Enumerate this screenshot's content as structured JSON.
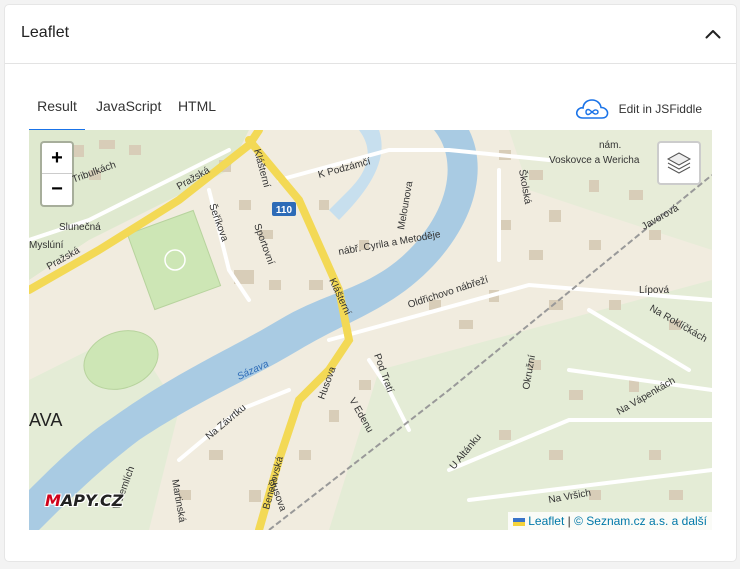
{
  "panel": {
    "title": "Leaflet"
  },
  "tabs": [
    {
      "label": "Result",
      "active": true
    },
    {
      "label": "JavaScript",
      "active": false
    },
    {
      "label": "HTML",
      "active": false
    }
  ],
  "jsfiddle": {
    "label": "Edit in JSFiddle",
    "icon": "cloud-icon"
  },
  "map": {
    "zoom_in": "+",
    "zoom_out": "−",
    "logo": {
      "prefix": "M",
      "rest": "APY.CZ"
    },
    "edge_label": "AVA",
    "attribution": {
      "leaflet": "Leaflet",
      "separator": "|",
      "copyright": "© Seznam.cz a.s. a další"
    },
    "street_labels": [
      "Na Tribulkách",
      "Pražská",
      "Pražská",
      "Slunečná",
      "Myslúní",
      "Šeříkova",
      "Sportovní",
      "Klášterní",
      "Klášterní",
      "K Podzámčí",
      "Melounova",
      "nábř. Cyrila a Metoděje",
      "110",
      "Sázava",
      "Školská",
      "nám.",
      "Voskovce a Wericha",
      "Javorová",
      "Oldřichovo nábřeží",
      "Lípová",
      "Na Roklíčkách",
      "Pod Tratí",
      "V Edenu",
      "Husova",
      "Husova",
      "Na Závrtku",
      "Benešovská",
      "Okružní",
      "Na Vápenkách",
      "U Altánku",
      "Na Vršich",
      "Martinská",
      "V Žemlích"
    ]
  }
}
